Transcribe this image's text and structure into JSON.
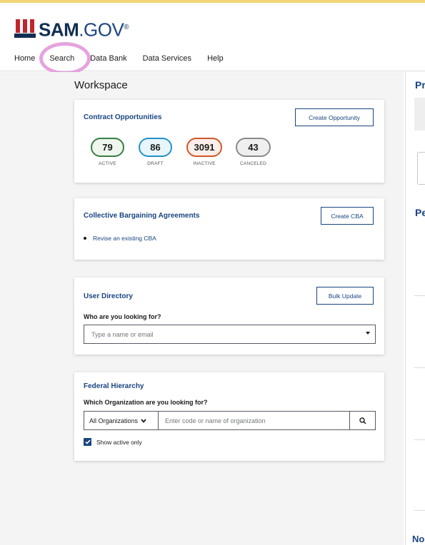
{
  "logo": {
    "brand": "SAM",
    "dot_gov": ".GOV",
    "trademark": "®"
  },
  "nav": {
    "items": [
      {
        "label": "Home"
      },
      {
        "label": "Search"
      },
      {
        "label": "Data Bank"
      },
      {
        "label": "Data Services"
      },
      {
        "label": "Help"
      }
    ]
  },
  "workspace": {
    "title": "Workspace"
  },
  "contract_opportunities": {
    "title": "Contract Opportunities",
    "button": "Create Opportunity",
    "stats": [
      {
        "value": "79",
        "label": "ACTIVE",
        "color": "#3a7d44"
      },
      {
        "value": "86",
        "label": "DRAFT",
        "color": "#2491c7"
      },
      {
        "value": "3091",
        "label": "INACTIVE",
        "color": "#d0572a"
      },
      {
        "value": "43",
        "label": "CANCELED",
        "color": "#8a8a8a"
      }
    ]
  },
  "cba": {
    "title": "Collective Bargaining Agreements",
    "button": "Create CBA",
    "link": "Revise an existing CBA"
  },
  "user_directory": {
    "title": "User Directory",
    "button": "Bulk Update",
    "label": "Who are you looking for?",
    "placeholder": "Type a name or email"
  },
  "federal_hierarchy": {
    "title": "Federal Hierarchy",
    "label": "Which Organization are you looking for?",
    "org_select": "All Organizations",
    "placeholder": "Enter code or name of organization",
    "checkbox_label": "Show active only"
  },
  "right_column": {
    "heading1": "Pr",
    "heading2": "Pe",
    "bottom_heading": "No"
  },
  "colors": {
    "brand_navy": "#1a4480",
    "highlight": "#e5a3de",
    "top_bar": "#f2d675"
  }
}
